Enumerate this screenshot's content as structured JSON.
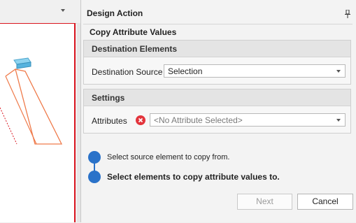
{
  "panel": {
    "title": "Design Action",
    "subtitle": "Copy Attribute Values",
    "pin_icon": "pin-icon"
  },
  "destination": {
    "heading": "Destination Elements",
    "source_label": "Destination Source",
    "source_value": "Selection"
  },
  "settings": {
    "heading": "Settings",
    "attributes_label": "Attributes",
    "attributes_placeholder": "<No Attribute Selected>",
    "error_icon": "error-icon"
  },
  "steps": [
    {
      "text": "Select source element to copy from."
    },
    {
      "text": "Select elements to copy attribute values to."
    }
  ],
  "buttons": {
    "next": "Next",
    "cancel": "Cancel"
  },
  "colors": {
    "accent": "#2a72c9",
    "viewport_border": "#d9141e",
    "error": "#e3343c",
    "shape_stroke": "#ef7a4a"
  }
}
